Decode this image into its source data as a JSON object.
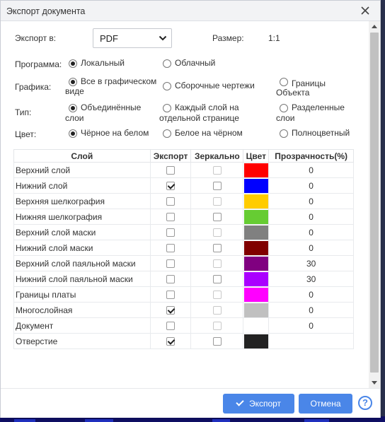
{
  "dialog": {
    "title": "Экспорт документа"
  },
  "export_to": {
    "label": "Экспорт в:",
    "value": "PDF"
  },
  "size": {
    "label": "Размер:",
    "value": "1:1"
  },
  "program": {
    "label": "Программа:",
    "options": [
      {
        "label": "Локальный",
        "checked": true
      },
      {
        "label": "Облачный",
        "checked": false
      }
    ]
  },
  "graphics": {
    "label": "Графика:",
    "options": [
      {
        "line1": "Все в графическом",
        "line2": "виде",
        "checked": true
      },
      {
        "line1": "Сборочные чертежи",
        "line2": "",
        "checked": false
      },
      {
        "line1": "Границы",
        "line2": "Объекта",
        "checked": false
      }
    ]
  },
  "type": {
    "label": "Тип:",
    "options": [
      {
        "line1": "Объединённые",
        "line2": "слои",
        "checked": true
      },
      {
        "line1": "Каждый слой на",
        "line2": "отдельной странице",
        "checked": false
      },
      {
        "line1": "Разделенные",
        "line2": "слои",
        "checked": false
      }
    ]
  },
  "color": {
    "label": "Цвет:",
    "options": [
      {
        "label": "Чёрное на белом",
        "checked": true
      },
      {
        "label": "Белое на чёрном",
        "checked": false
      },
      {
        "label": "Полноцветный",
        "checked": false
      }
    ]
  },
  "table": {
    "headers": {
      "layer": "Слой",
      "export": "Экспорт",
      "mirror": "Зеркально",
      "color": "Цвет",
      "transparency": "Прозрачность(%)"
    },
    "rows": [
      {
        "name": "Верхний слой",
        "export": false,
        "mirror": false,
        "mirror_enabled": false,
        "color": "#ff0000",
        "transparency": "0"
      },
      {
        "name": "Нижний слой",
        "export": true,
        "mirror": false,
        "mirror_enabled": true,
        "color": "#0000ff",
        "transparency": "0"
      },
      {
        "name": "Верхняя шелкография",
        "export": false,
        "mirror": false,
        "mirror_enabled": false,
        "color": "#ffcc00",
        "transparency": "0"
      },
      {
        "name": "Нижняя шелкография",
        "export": false,
        "mirror": false,
        "mirror_enabled": true,
        "color": "#66cc33",
        "transparency": "0"
      },
      {
        "name": "Верхний слой маски",
        "export": false,
        "mirror": false,
        "mirror_enabled": false,
        "color": "#808080",
        "transparency": "0"
      },
      {
        "name": "Нижний слой маски",
        "export": false,
        "mirror": false,
        "mirror_enabled": true,
        "color": "#800000",
        "transparency": "0"
      },
      {
        "name": "Верхний слой паяльной маски",
        "export": false,
        "mirror": false,
        "mirror_enabled": false,
        "color": "#800080",
        "transparency": "30"
      },
      {
        "name": "Нижний слой паяльной маски",
        "export": false,
        "mirror": false,
        "mirror_enabled": true,
        "color": "#aa00ff",
        "transparency": "30"
      },
      {
        "name": "Границы платы",
        "export": false,
        "mirror": false,
        "mirror_enabled": false,
        "color": "#ff00ff",
        "transparency": "0"
      },
      {
        "name": "Многослойная",
        "export": true,
        "mirror": false,
        "mirror_enabled": false,
        "color": "#c0c0c0",
        "transparency": "0"
      },
      {
        "name": "Документ",
        "export": false,
        "mirror": false,
        "mirror_enabled": false,
        "color": "#ffffff",
        "transparency": "0"
      },
      {
        "name": "Отверстие",
        "export": true,
        "mirror": false,
        "mirror_enabled": true,
        "color": "#222222",
        "transparency": ""
      }
    ]
  },
  "footer": {
    "export_label": "Экспорт",
    "cancel_label": "Отмена",
    "help_label": "?"
  },
  "colors": {
    "accent": "#4a86e8"
  }
}
